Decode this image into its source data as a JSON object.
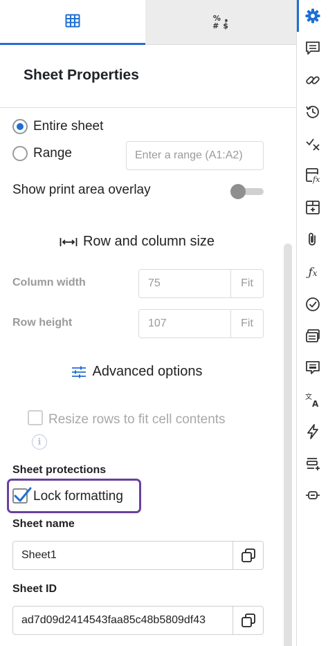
{
  "tabs": [
    {
      "name": "grid-tab",
      "icon": "table-grid-icon",
      "active": true
    },
    {
      "name": "number-format-tab",
      "icon": "number-format-icon",
      "symbols": [
        "%",
        "❟",
        "#",
        "$"
      ],
      "active": false
    }
  ],
  "header": {
    "title": "Sheet Properties"
  },
  "print_area": {
    "options": [
      {
        "label": "Entire sheet",
        "selected": true
      },
      {
        "label": "Range",
        "selected": false
      }
    ],
    "range_placeholder": "Enter a range (A1:A2)",
    "overlay_label": "Show print area overlay",
    "overlay_on": false
  },
  "row_col": {
    "title": "Row and column size",
    "column_width_label": "Column width",
    "column_width_value": "75",
    "row_height_label": "Row height",
    "row_height_value": "107",
    "fit_label": "Fit"
  },
  "advanced": {
    "title": "Advanced options",
    "resize_label": "Resize rows to fit cell contents",
    "resize_checked": false,
    "info_glyph": "i"
  },
  "protections": {
    "title": "Sheet protections",
    "lock_label": "Lock formatting",
    "lock_checked": true,
    "highlight_color": "#6a3fa0"
  },
  "sheet_name": {
    "label": "Sheet name",
    "value": "Sheet1"
  },
  "sheet_id": {
    "label": "Sheet ID",
    "value": "ad7d09d2414543faa85c48b5809df43"
  },
  "accent_color": "#1f6fd1",
  "rail_icons": [
    "gear-icon",
    "comment-icon",
    "link-icon",
    "history-icon",
    "check-cross-icon",
    "function-sheet-icon",
    "table-insert-icon",
    "attachment-icon",
    "fx-icon",
    "check-circle-icon",
    "cards-icon",
    "note-icon",
    "translate-icon",
    "lightning-icon",
    "list-add-icon",
    "connector-icon"
  ]
}
